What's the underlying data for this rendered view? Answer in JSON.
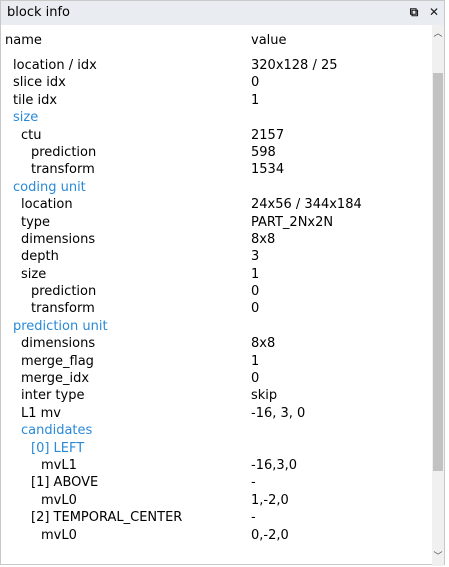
{
  "panel": {
    "title": "block info",
    "float_glyph": "⧉",
    "close_glyph": "✕"
  },
  "table": {
    "columns": [
      "name",
      "value"
    ],
    "rows": [
      {
        "name": "location / idx",
        "value": "320x128 / 25",
        "level": 1,
        "section": false
      },
      {
        "name": "slice idx",
        "value": "0",
        "level": 1,
        "section": false
      },
      {
        "name": "tile idx",
        "value": "1",
        "level": 1,
        "section": false
      },
      {
        "name": "size",
        "value": "",
        "level": 1,
        "section": true
      },
      {
        "name": "ctu",
        "value": "2157",
        "level": 2,
        "section": false
      },
      {
        "name": "prediction",
        "value": "598",
        "level": 3,
        "section": false
      },
      {
        "name": "transform",
        "value": "1534",
        "level": 3,
        "section": false
      },
      {
        "name": "coding unit",
        "value": "",
        "level": 1,
        "section": true
      },
      {
        "name": "location",
        "value": "24x56 / 344x184",
        "level": 2,
        "section": false
      },
      {
        "name": "type",
        "value": "PART_2Nx2N",
        "level": 2,
        "section": false
      },
      {
        "name": "dimensions",
        "value": "8x8",
        "level": 2,
        "section": false
      },
      {
        "name": "depth",
        "value": "3",
        "level": 2,
        "section": false
      },
      {
        "name": "size",
        "value": "1",
        "level": 2,
        "section": false
      },
      {
        "name": "prediction",
        "value": "0",
        "level": 3,
        "section": false
      },
      {
        "name": "transform",
        "value": "0",
        "level": 3,
        "section": false
      },
      {
        "name": "prediction unit",
        "value": "",
        "level": 1,
        "section": true
      },
      {
        "name": "dimensions",
        "value": "8x8",
        "level": 2,
        "section": false
      },
      {
        "name": "merge_flag",
        "value": "1",
        "level": 2,
        "section": false
      },
      {
        "name": "merge_idx",
        "value": "0",
        "level": 2,
        "section": false
      },
      {
        "name": "inter type",
        "value": "skip",
        "level": 2,
        "section": false
      },
      {
        "name": "L1 mv",
        "value": "-16, 3, 0",
        "level": 2,
        "section": false
      },
      {
        "name": "candidates",
        "value": "",
        "level": 2,
        "section": true
      },
      {
        "name": "[0] LEFT",
        "value": "",
        "level": 3,
        "section": true
      },
      {
        "name": "mvL1",
        "value": "-16,3,0",
        "level": 4,
        "section": false
      },
      {
        "name": "[1] ABOVE",
        "value": "-",
        "level": 3,
        "section": false
      },
      {
        "name": "mvL0",
        "value": "1,-2,0",
        "level": 4,
        "section": false
      },
      {
        "name": "[2] TEMPORAL_CENTER",
        "value": "-",
        "level": 3,
        "section": false
      },
      {
        "name": "mvL0",
        "value": "0,-2,0",
        "level": 4,
        "section": false
      }
    ]
  },
  "scrollbar": {
    "up_glyph": "︿",
    "down_glyph": "﹀"
  },
  "colors": {
    "section_text": "#2a8ad8",
    "titlebar_bg": "#e9edf2",
    "scroll_thumb": "#c2c2c2"
  }
}
